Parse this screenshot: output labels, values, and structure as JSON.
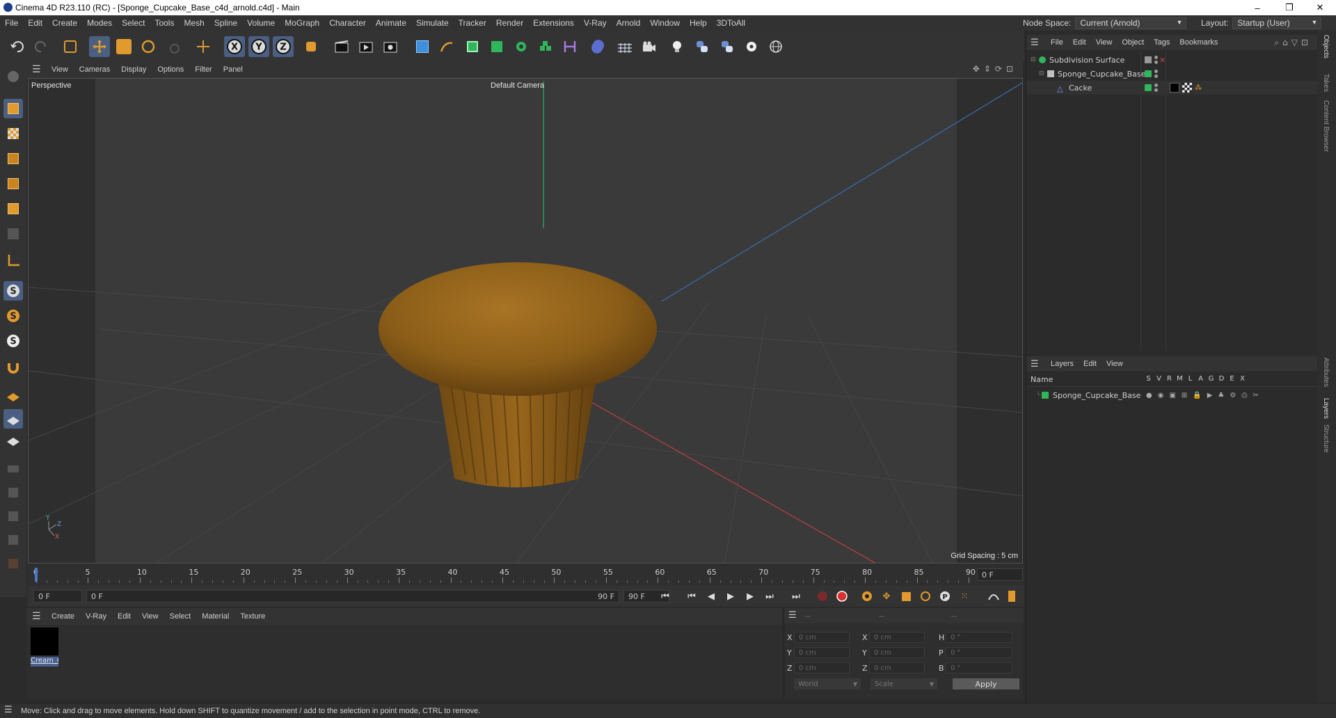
{
  "window": {
    "title": "Cinema 4D R23.110 (RC) - [Sponge_Cupcake_Base_c4d_arnold.c4d] - Main",
    "controls": [
      "–",
      "❐",
      "✕"
    ]
  },
  "menubar": {
    "items": [
      "File",
      "Edit",
      "Create",
      "Modes",
      "Select",
      "Tools",
      "Mesh",
      "Spline",
      "Volume",
      "MoGraph",
      "Character",
      "Animate",
      "Simulate",
      "Tracker",
      "Render",
      "Extensions",
      "V-Ray",
      "Arnold",
      "Window",
      "Help",
      "3DToAll"
    ],
    "node_space_label": "Node Space:",
    "node_space_value": "Current (Arnold)",
    "layout_label": "Layout:",
    "layout_value": "Startup (User)"
  },
  "toolbar": {
    "axis_x": "X",
    "axis_y": "Y",
    "axis_z": "Z"
  },
  "viewport": {
    "menu": [
      "View",
      "Cameras",
      "Display",
      "Options",
      "Filter",
      "Panel"
    ],
    "label": "Perspective",
    "camera": "Default Camera",
    "grid_spacing": "Grid Spacing : 5 cm",
    "axes": {
      "y": "Y",
      "z": "Z",
      "x": "X"
    }
  },
  "timeline": {
    "ticks": [
      "0",
      "5",
      "10",
      "15",
      "20",
      "25",
      "30",
      "35",
      "40",
      "45",
      "50",
      "55",
      "60",
      "65",
      "70",
      "75",
      "80",
      "85",
      "90"
    ],
    "current_frame": "0 F"
  },
  "transport": {
    "start": "0 F",
    "range_start": "0 F",
    "range_end": "90 F",
    "end": "90 F"
  },
  "material_menu": [
    "Create",
    "V-Ray",
    "Edit",
    "View",
    "Select",
    "Material",
    "Texture"
  ],
  "materials": [
    {
      "name": "Cream_C"
    }
  ],
  "coords": {
    "header": [
      "--",
      "--",
      "--"
    ],
    "rows": [
      {
        "l1": "X",
        "v1": "0 cm",
        "l2": "X",
        "v2": "0 cm",
        "l3": "H",
        "v3": "0 °"
      },
      {
        "l1": "Y",
        "v1": "0 cm",
        "l2": "Y",
        "v2": "0 cm",
        "l3": "P",
        "v3": "0 °"
      },
      {
        "l1": "Z",
        "v1": "0 cm",
        "l2": "Z",
        "v2": "0 cm",
        "l3": "B",
        "v3": "0 °"
      }
    ],
    "space": "World",
    "mode": "Scale",
    "apply": "Apply"
  },
  "objects": {
    "menu": [
      "File",
      "Edit",
      "View",
      "Object",
      "Tags",
      "Bookmarks"
    ],
    "items": [
      {
        "name": "Subdivision Surface",
        "indent": 0
      },
      {
        "name": "Sponge_Cupcake_Base",
        "indent": 1
      },
      {
        "name": "Cacke",
        "indent": 2
      }
    ]
  },
  "layers": {
    "menu": [
      "Layers",
      "Edit",
      "View"
    ],
    "header_name": "Name",
    "columns": [
      "S",
      "V",
      "R",
      "M",
      "L",
      "A",
      "G",
      "D",
      "E",
      "X"
    ],
    "items": [
      {
        "name": "Sponge_Cupcake_Base"
      }
    ]
  },
  "right_tabs": [
    "Objects",
    "Takes",
    "Content Browser",
    "Attributes",
    "Layers",
    "Structure"
  ],
  "status": "Move: Click and drag to move elements. Hold down SHIFT to quantize movement / add to the selection in point mode, CTRL to remove.",
  "colors": {
    "accent": "#4a5f82",
    "layer_green": "#2fb55b",
    "cupcake": "#9a6a1c"
  }
}
